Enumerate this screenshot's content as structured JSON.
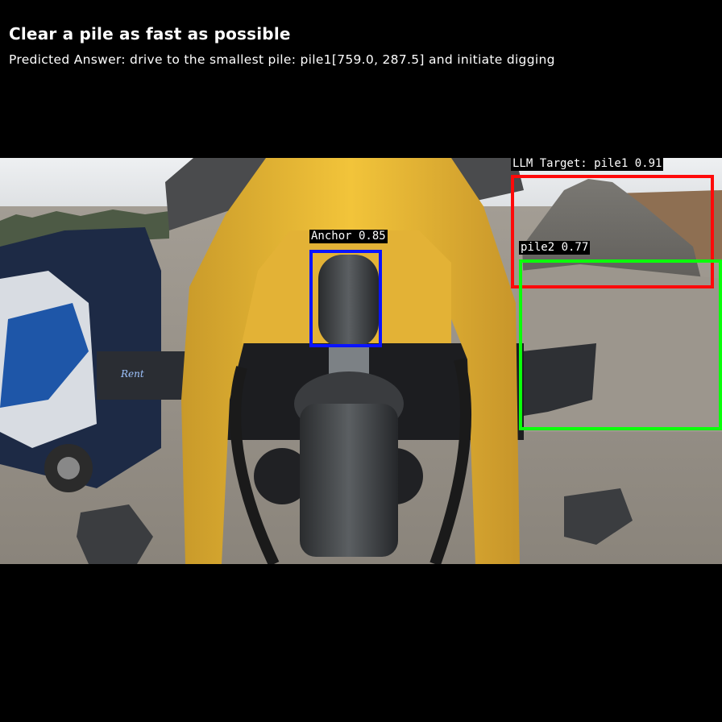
{
  "header": {
    "title": "Clear a pile as fast as possible",
    "prediction": "Predicted Answer: drive to the smallest pile: pile1[759.0, 287.5] and initiate digging"
  },
  "detections": [
    {
      "label": "Anchor 0.85",
      "color": "#0a14ff"
    },
    {
      "label": "LLM Target: pile1 0.91",
      "color": "#ff0a0a"
    },
    {
      "label": "pile2 0.77",
      "color": "#0aff0a"
    }
  ],
  "scene": {
    "truck_badge": "Rent"
  }
}
